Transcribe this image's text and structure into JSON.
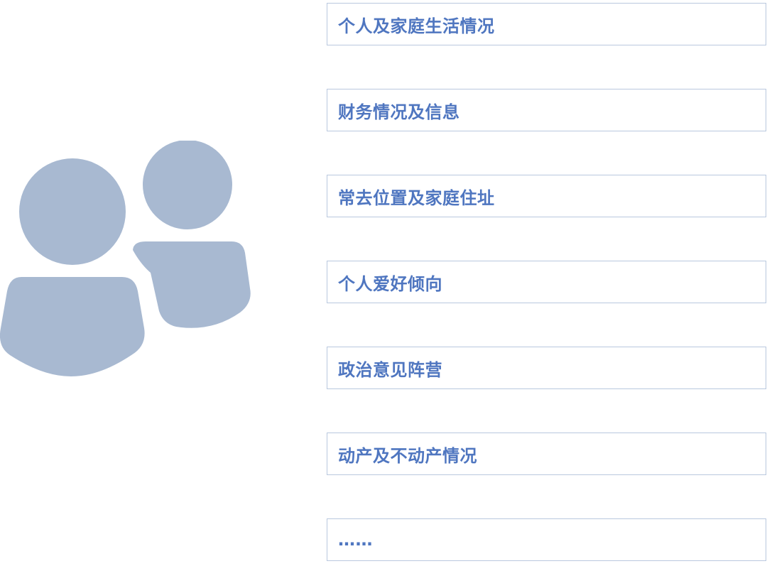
{
  "colors": {
    "icon_fill": "#a8b9d1",
    "box_border": "#b9c8de",
    "label_text": "#4f76c0"
  },
  "icon": {
    "name": "users-icon"
  },
  "items": [
    {
      "label": "个人及家庭生活情况"
    },
    {
      "label": "财务情况及信息"
    },
    {
      "label": "常去位置及家庭住址"
    },
    {
      "label": "个人爱好倾向"
    },
    {
      "label": "政治意见阵营"
    },
    {
      "label": "动产及不动产情况"
    },
    {
      "label": "……"
    }
  ]
}
